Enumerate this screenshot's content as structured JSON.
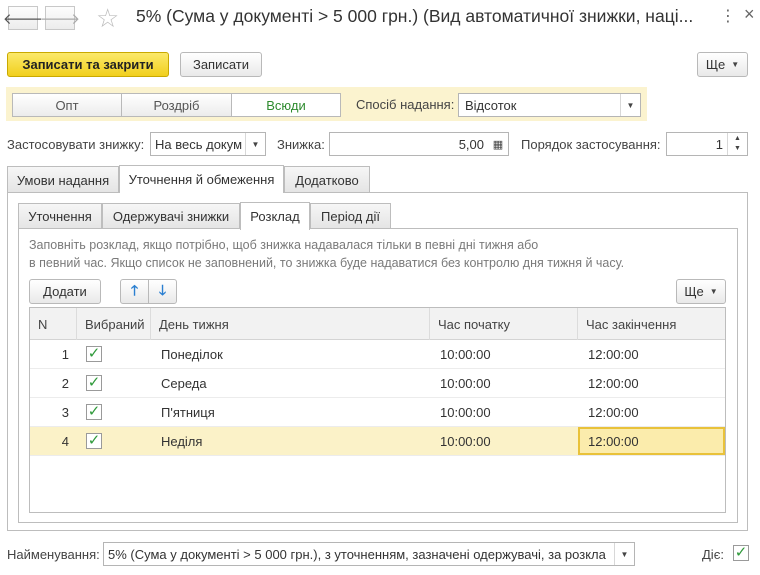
{
  "window": {
    "title": "5% (Сума у документі > 5 000 грн.) (Вид автоматичної знижки, наці...",
    "more": "⋮",
    "close": "×"
  },
  "toolbar": {
    "save_close": "Записати та закрити",
    "save": "Записати",
    "more": "Ще"
  },
  "scope": {
    "options": [
      "Опт",
      "Роздріб",
      "Всюди"
    ],
    "active": "Всюди",
    "method_label": "Спосіб надання:",
    "method_value": "Відсоток"
  },
  "apply": {
    "label": "Застосовувати знижку:",
    "value": "На весь докум",
    "discount_label": "Знижка:",
    "discount_value": "5,00",
    "order_label": "Порядок застосування:",
    "order_value": "1"
  },
  "tabs": [
    "Умови надання",
    "Уточнення й обмеження",
    "Додатково"
  ],
  "active_tab": "Уточнення й обмеження",
  "subtabs": [
    "Уточнення",
    "Одержувачі знижки",
    "Розклад",
    "Період дії"
  ],
  "active_subtab": "Розклад",
  "hint": {
    "line1": "Заповніть розклад, якщо потрібно, щоб знижка надавалася тільки в певні дні тижня або",
    "line2": "в певний час. Якщо список не заповнений, то знижка буде надаватися без контролю дня тижня й часу."
  },
  "table_toolbar": {
    "add": "Додати",
    "more": "Ще"
  },
  "table": {
    "columns": [
      "N",
      "Вибраний",
      "День тижня",
      "Час початку",
      "Час закінчення"
    ],
    "rows": [
      {
        "n": "1",
        "selected": true,
        "day": "Понеділок",
        "start": "10:00:00",
        "end": "12:00:00"
      },
      {
        "n": "2",
        "selected": true,
        "day": "Середа",
        "start": "10:00:00",
        "end": "12:00:00"
      },
      {
        "n": "3",
        "selected": true,
        "day": "П'ятниця",
        "start": "10:00:00",
        "end": "12:00:00"
      },
      {
        "n": "4",
        "selected": true,
        "day": "Неділя",
        "start": "10:00:00",
        "end": "12:00:00"
      }
    ],
    "selected_row": 4
  },
  "footer": {
    "name_label": "Найменування:",
    "name_value": "5% (Сума у документі > 5 000 грн.), з уточненням, зазначені одержувачі, за розкла",
    "active_label": "Діє:",
    "active": true
  },
  "colors": {
    "primary": "#f1cf1d",
    "selection": "#fbf2c8",
    "check": "#2f9a3a",
    "active_segment_text": "#2e8b2e"
  },
  "icons": [
    "back-arrow-icon",
    "forward-arrow-icon",
    "star-icon",
    "calculator-icon",
    "arrow-up-icon",
    "arrow-down-icon",
    "checkmark-icon"
  ]
}
